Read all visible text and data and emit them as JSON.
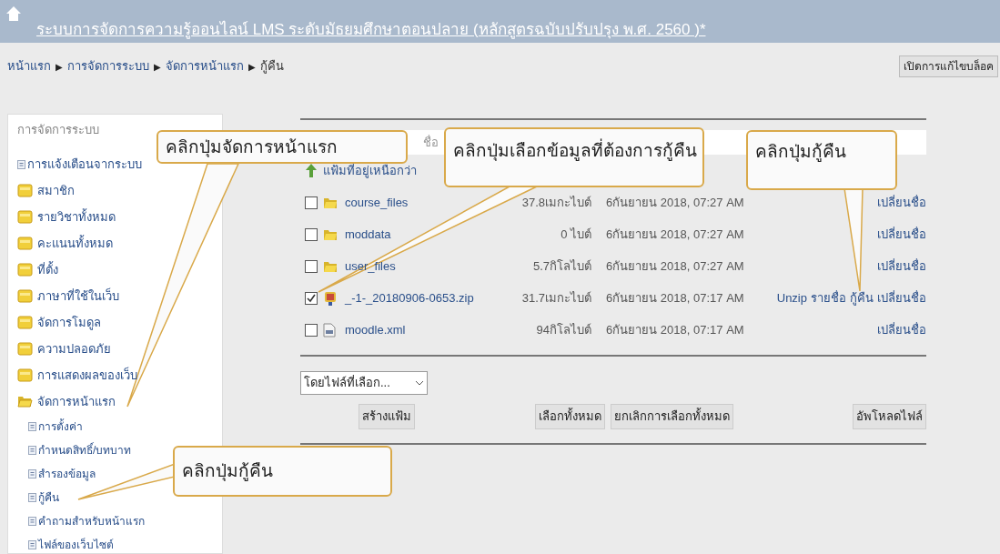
{
  "header": {
    "title": "ระบบการจัดการความรู้ออนไลน์ LMS ระดับมัธยมศึกษาตอนปลาย (หลักสูตรฉบับปรับปรุง พ.ศ. 2560 )*"
  },
  "breadcrumb": [
    "หน้าแรก",
    "การจัดการระบบ",
    "จัดการหน้าแรก",
    "กู้คืน"
  ],
  "breadcrumb_separator": "▶",
  "edit_button": "เปิดการแก้ไขบล็อค",
  "sidebar": {
    "title": "การจัดการระบบ",
    "items": [
      {
        "kind": "link",
        "label": "การแจ้งเตือนจากระบบ"
      },
      {
        "kind": "folder",
        "label": "สมาชิก",
        "expanded": false
      },
      {
        "kind": "folder",
        "label": "รายวิชาทั้งหมด",
        "expanded": false
      },
      {
        "kind": "folder",
        "label": "คะแนนทั้งหมด",
        "expanded": false
      },
      {
        "kind": "folder",
        "label": "ที่ตั้ง",
        "expanded": false
      },
      {
        "kind": "folder",
        "label": "ภาษาที่ใช้ในเว็บ",
        "expanded": false
      },
      {
        "kind": "folder",
        "label": "จัดการโมดูล",
        "expanded": false
      },
      {
        "kind": "folder",
        "label": "ความปลอดภัย",
        "expanded": false
      },
      {
        "kind": "folder",
        "label": "การแสดงผลของเว็บ",
        "expanded": false
      },
      {
        "kind": "folder",
        "label": "จัดการหน้าแรก",
        "expanded": true,
        "children": [
          {
            "kind": "link",
            "label": "การตั้งค่า"
          },
          {
            "kind": "link",
            "label": "กำหนดสิทธิ์/บทบาท"
          },
          {
            "kind": "link",
            "label": "สำรองข้อมูล"
          },
          {
            "kind": "link",
            "label": "กู้คืน"
          },
          {
            "kind": "link",
            "label": "คำถามสำหรับหน้าแรก"
          },
          {
            "kind": "link",
            "label": "ไฟล์ของเว็บไซต์"
          }
        ]
      }
    ]
  },
  "files": {
    "column_1": "ชื่อ",
    "rows": [
      {
        "kind": "parent",
        "name": "แฟ้มที่อยู่เหนือกว่า"
      },
      {
        "kind": "folder",
        "checked": false,
        "name": "course_files",
        "size": "37.8เมกะไบต์",
        "modified": "6กันยายน 2018, 07:27 AM",
        "actions": [
          "เปลี่ยนชื่อ"
        ]
      },
      {
        "kind": "folder",
        "checked": false,
        "name": "moddata",
        "size": "0 ไบต์",
        "modified": "6กันยายน 2018, 07:27 AM",
        "actions": [
          "เปลี่ยนชื่อ"
        ]
      },
      {
        "kind": "folder",
        "checked": false,
        "name": "user_files",
        "size": "5.7กิโลไบต์",
        "modified": "6กันยายน 2018, 07:27 AM",
        "actions": [
          "เปลี่ยนชื่อ"
        ]
      },
      {
        "kind": "zip",
        "checked": true,
        "name": "_-1-_20180906-0653.zip",
        "size": "31.7เมกะไบต์",
        "modified": "6กันยายน 2018, 07:17 AM",
        "actions": [
          "Unzip",
          "รายชื่อ",
          "กู้คืน",
          "เปลี่ยนชื่อ"
        ]
      },
      {
        "kind": "xml",
        "checked": false,
        "name": "moodle.xml",
        "size": "94กิโลไบต์",
        "modified": "6กันยายน 2018, 07:17 AM",
        "actions": [
          "เปลี่ยนชื่อ"
        ]
      }
    ],
    "bulk_select": "โดยไฟล์ที่เลือก...",
    "buttons": [
      "สร้างแฟ้ม",
      "เลือกทั้งหมด",
      "ยกเลิกการเลือกทั้งหมด",
      "อัพโหลดไฟล์"
    ]
  },
  "callouts": [
    "คลิกปุ่มจัดการหน้าแรก",
    "คลิกปุ่มเลือกข้อมูลที่ต้องการกู้คืน",
    "คลิกปุ่มกู้คืน",
    "คลิกปุ่มกู้คืน"
  ]
}
